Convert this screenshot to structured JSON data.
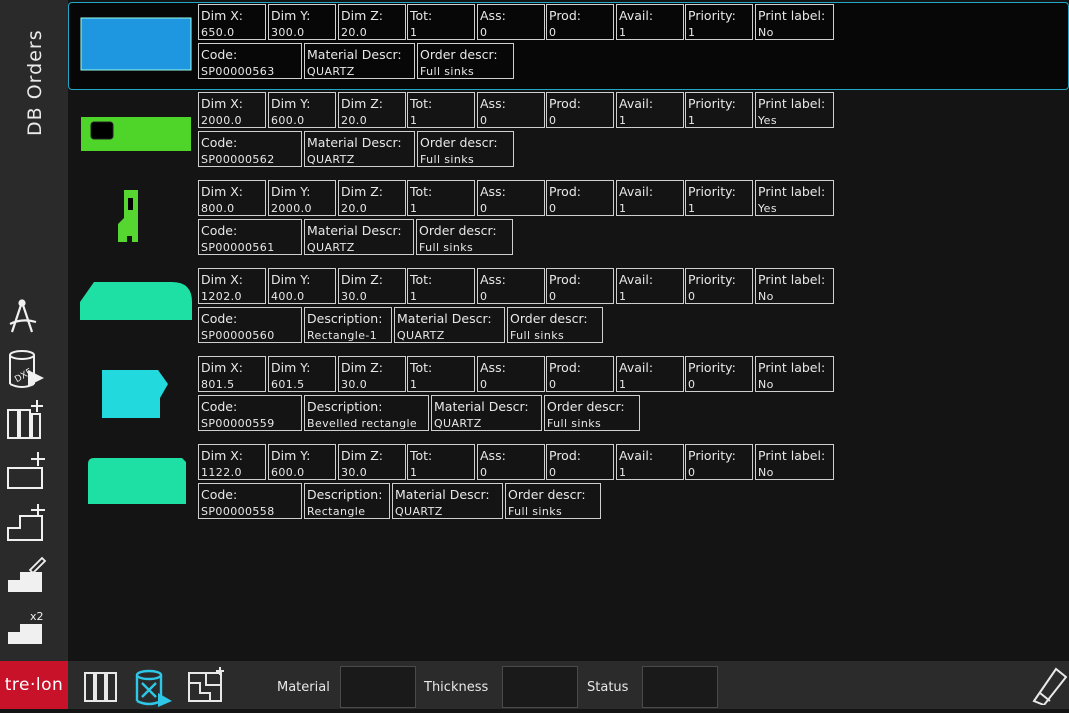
{
  "sidebar": {
    "title": "DB Orders",
    "buttons": [
      {
        "name": "compass-tool-icon"
      },
      {
        "name": "dxf-import-icon"
      },
      {
        "name": "add-slabs-icon"
      },
      {
        "name": "add-rectangle-icon"
      },
      {
        "name": "add-shape-icon"
      },
      {
        "name": "edit-piece-icon"
      },
      {
        "name": "duplicate-piece-icon"
      }
    ]
  },
  "labels": {
    "dim_x": "Dim X:",
    "dim_y": "Dim Y:",
    "dim_z": "Dim Z:",
    "tot": "Tot:",
    "ass": "Ass:",
    "prod": "Prod:",
    "avail": "Avail:",
    "priority": "Priority:",
    "print_label": "Print label:",
    "code": "Code:",
    "description": "Description:",
    "material_descr": "Material Descr:",
    "order_descr": "Order descr:"
  },
  "orders": [
    {
      "dim_x": "650.0",
      "dim_y": "300.0",
      "dim_z": "20.0",
      "tot": "1",
      "ass": "0",
      "prod": "0",
      "avail": "1",
      "priority": "1",
      "print_label": "No",
      "code": "SP00000563",
      "material_descr": "QUARTZ",
      "order_descr": "Full sinks",
      "shape": "rect",
      "color": "#1e96e0"
    },
    {
      "dim_x": "2000.0",
      "dim_y": "600.0",
      "dim_z": "20.0",
      "tot": "1",
      "ass": "0",
      "prod": "0",
      "avail": "1",
      "priority": "1",
      "print_label": "Yes",
      "code": "SP00000562",
      "material_descr": "QUARTZ",
      "order_descr": "Full sinks",
      "shape": "rect-hole",
      "color": "#4fd52a"
    },
    {
      "dim_x": "800.0",
      "dim_y": "2000.0",
      "dim_z": "20.0",
      "tot": "1",
      "ass": "0",
      "prod": "0",
      "avail": "1",
      "priority": "1",
      "print_label": "Yes",
      "code": "SP00000561",
      "material_descr": "QUARTZ",
      "order_descr": "Full sinks",
      "shape": "narrow-notch",
      "color": "#56d630"
    },
    {
      "dim_x": "1202.0",
      "dim_y": "400.0",
      "dim_z": "30.0",
      "tot": "1",
      "ass": "0",
      "prod": "0",
      "avail": "1",
      "priority": "0",
      "print_label": "No",
      "code": "SP00000560",
      "description": "Rectangle-1",
      "material_descr": "QUARTZ",
      "order_descr": "Full sinks",
      "shape": "chamfer-round",
      "color": "#1fe0a4"
    },
    {
      "dim_x": "801.5",
      "dim_y": "601.5",
      "dim_z": "30.0",
      "tot": "1",
      "ass": "0",
      "prod": "0",
      "avail": "1",
      "priority": "0",
      "print_label": "No",
      "code": "SP00000559",
      "description": "Bevelled rectangle",
      "material_descr": "QUARTZ",
      "order_descr": "Full sinks",
      "shape": "bevel",
      "color": "#22d9de"
    },
    {
      "dim_x": "1122.0",
      "dim_y": "600.0",
      "dim_z": "30.0",
      "tot": "1",
      "ass": "0",
      "prod": "0",
      "avail": "1",
      "priority": "0",
      "print_label": "No",
      "code": "SP00000558",
      "description": "Rectangle",
      "material_descr": "QUARTZ",
      "order_descr": "Full sinks",
      "shape": "round-rect",
      "color": "#1fe0a4"
    }
  ],
  "bottom": {
    "logo": "tre·lon",
    "material_label": "Material",
    "thickness_label": "Thickness",
    "status_label": "Status",
    "material_value": "",
    "thickness_value": "",
    "status_value": ""
  },
  "colors": {
    "accent": "#1fa9c6",
    "brand": "#c8122a"
  }
}
